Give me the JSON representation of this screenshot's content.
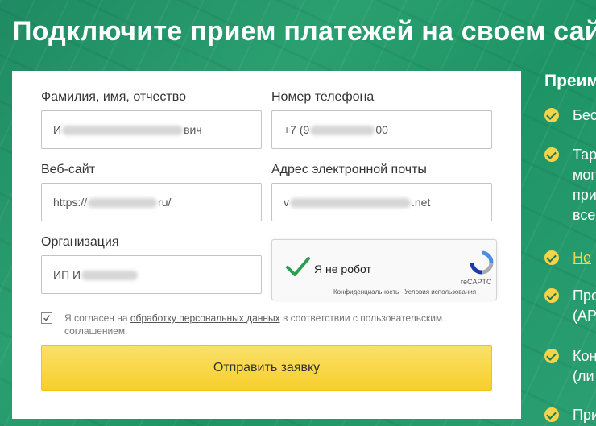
{
  "header": {
    "title": "Подключите прием платежей на своем сай"
  },
  "form": {
    "fio": {
      "label": "Фамилия, имя, отчество",
      "value_start": "И",
      "value_end": "вич"
    },
    "phone": {
      "label": "Номер телефона",
      "value_start": "+7 (9",
      "value_end": "00"
    },
    "website": {
      "label": "Веб-сайт",
      "value_start": "https://",
      "value_end": "ru/"
    },
    "email": {
      "label": "Адрес электронной почты",
      "value_start": "v",
      "value_end": ".net"
    },
    "organization": {
      "label": "Организация",
      "value_start": "ИП И",
      "value_end": ""
    }
  },
  "captcha": {
    "label": "Я не робот",
    "brand": "reCAPTC",
    "links": "Конфиденциальность - Условия использования"
  },
  "consent": {
    "checked": true,
    "text_before": "Я согласен на ",
    "link": "обработку персональных данных",
    "text_after": " в соответствии с пользовательским соглашением."
  },
  "submit": {
    "label": "Отправить заявку"
  },
  "benefits": {
    "title": "Преим",
    "items": [
      {
        "lines": [
          "Бес"
        ]
      },
      {
        "lines": [
          "Тар",
          "мог",
          "при",
          "всег"
        ]
      },
      {
        "lines": [
          "Не "
        ],
        "link": true
      },
      {
        "lines": [
          "Про",
          "(АР"
        ]
      },
      {
        "lines": [
          "Кон",
          "(ли"
        ]
      },
      {
        "lines": [
          "При"
        ]
      }
    ]
  },
  "colors": {
    "accent": "#f5d44a",
    "background": "#1f8a63",
    "check": "#2e9e4f"
  }
}
